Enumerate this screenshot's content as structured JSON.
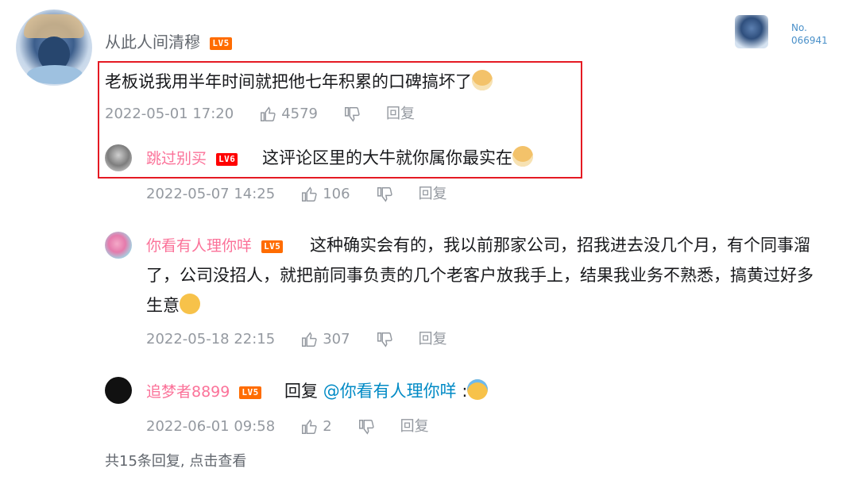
{
  "root_comment": {
    "username": "从此人间清穆",
    "level": "LV5",
    "content": "老板说我用半年时间就把他七年积累的口碑搞坏了",
    "time": "2022-05-01 17:20",
    "likes": "4579",
    "reply_label": "回复",
    "badge_no_label": "No.",
    "badge_no_value": "066941"
  },
  "replies": [
    {
      "username": "跳过别买",
      "level": "LV6",
      "content": "这评论区里的大牛就你属你最实在",
      "time": "2022-05-07 14:25",
      "likes": "106",
      "reply_label": "回复"
    },
    {
      "username": "你看有人理你咩",
      "level": "LV5",
      "content": "这种确实会有的，我以前那家公司，招我进去没几个月，有个同事溜了，公司没招人，就把前同事负责的几个老客户放我手上，结果我业务不熟悉，搞黄过好多生意",
      "time": "2022-05-18 22:15",
      "likes": "307",
      "reply_label": "回复"
    },
    {
      "username": "追梦者8899",
      "level": "LV5",
      "content_prefix": "回复 ",
      "mention": "@你看有人理你咩",
      "content_suffix": " :",
      "time": "2022-06-01 09:58",
      "likes": "2",
      "reply_label": "回复"
    }
  ],
  "view_more": "共15条回复, 点击查看",
  "colors": {
    "highlight_border": "#e51a23",
    "username_pink": "#fb7299",
    "mention_blue": "#008ac5",
    "meta_gray": "#9499a0"
  },
  "icons": {
    "like": "thumbs-up-icon",
    "dislike": "thumbs-down-icon"
  }
}
